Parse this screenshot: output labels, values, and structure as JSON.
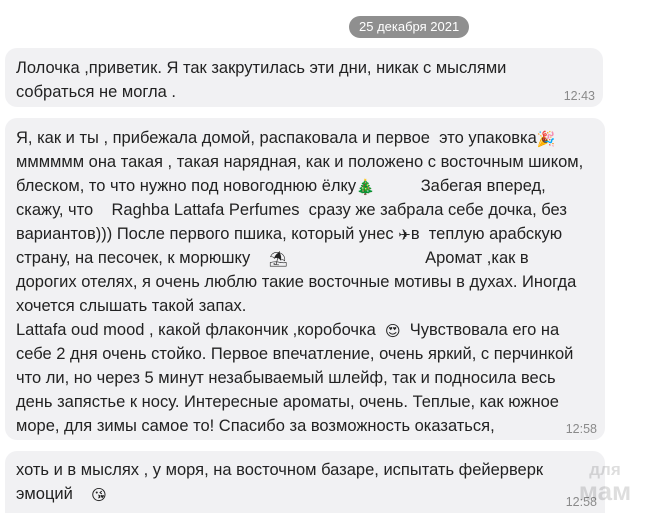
{
  "date_separator": "25 декабря 2021",
  "messages": [
    {
      "time": "12:43",
      "lines": [
        "Лолочка ,приветик. Я так закрутилась эти дни, никак с мыслями",
        "собраться не могла ."
      ]
    },
    {
      "time": "12:58",
      "lines": [
        "Я, как и ты , прибежала домой, распаковала и первое  это упаковка",
        "мммммм она такая , такая нарядная, как и положено с восточным шиком,",
        "блеском, то что нужно под новогоднюю ёлку",
        "скажу, что    Raghba Lattafa Perfumes  сразу же забрала себе дочка, без",
        "вариантов))) После первого пшика, который унес",
        "страну, на песочек, к морюшку",
        "дорогих отелях, я очень люблю такие восточные мотивы в духах. Иногда",
        "хочется слышать такой запах.",
        "Lattafa oud mood , какой флакончик ,коробочка",
        "себе 2 дня очень стойко. Первое впечатление, очень яркий, с перчинкой",
        "что ли, но через 5 минут незабываемый шлейф, так и подносила весь",
        "день запястье к носу. Интересные ароматы, очень. Теплые, как южное",
        "море, для зимы самое то! Спасибо за возможность оказаться,"
      ],
      "line3_tail": "Забегая вперед,",
      "line5_tail": "в  теплую арабскую",
      "line6_tail": "Аромат ,как в",
      "line9_tail": "Чувствовала его на"
    },
    {
      "time": "12:58",
      "lines": [
        "хоть и в мыслях , у моря, на восточном базаре, испытать фейерверк",
        "эмоций"
      ]
    }
  ],
  "emoji": {
    "party": "🎉",
    "tree": "🎄",
    "plane": "✈",
    "beach": "⛱",
    "heart_eyes": "😍",
    "kiss": "😘"
  },
  "watermark": {
    "line1": "для",
    "line2": "мам"
  }
}
